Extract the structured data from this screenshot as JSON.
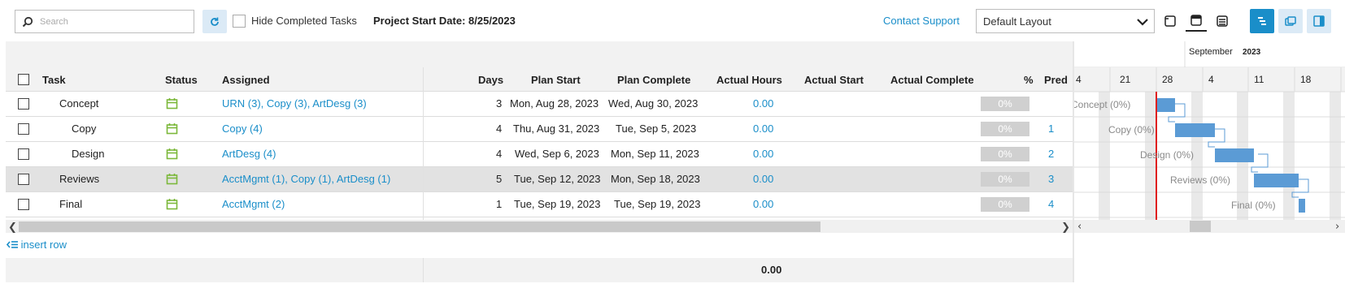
{
  "toolbar": {
    "search_placeholder": "Search",
    "hide_completed_label": "Hide Completed Tasks",
    "project_start_label": "Project Start Date: 8/25/2023",
    "contact_support": "Contact Support",
    "layout_value": "Default Layout"
  },
  "columns": {
    "task": "Task",
    "status": "Status",
    "assigned": "Assigned",
    "days": "Days",
    "plan_start": "Plan Start",
    "plan_complete": "Plan Complete",
    "actual_hours": "Actual Hours",
    "actual_start": "Actual Start",
    "actual_complete": "Actual Complete",
    "pct": "%",
    "pred": "Pred"
  },
  "rows": [
    {
      "task": "Concept",
      "assigned": "URN (3), Copy (3), ArtDesg (3)",
      "days": "3",
      "plan_start": "Mon, Aug 28, 2023",
      "plan_complete": "Wed, Aug 30, 2023",
      "actual_hours": "0.00",
      "pct": "0%",
      "pred": ""
    },
    {
      "task": "Copy",
      "assigned": "Copy (4)",
      "days": "4",
      "plan_start": "Thu, Aug 31, 2023",
      "plan_complete": "Tue, Sep 5, 2023",
      "actual_hours": "0.00",
      "pct": "0%",
      "pred": "1"
    },
    {
      "task": "Design",
      "assigned": "ArtDesg (4)",
      "days": "4",
      "plan_start": "Wed, Sep 6, 2023",
      "plan_complete": "Mon, Sep 11, 2023",
      "actual_hours": "0.00",
      "pct": "0%",
      "pred": "2"
    },
    {
      "task": "Reviews",
      "assigned": "AcctMgmt (1), Copy (1), ArtDesg (1)",
      "days": "5",
      "plan_start": "Tue, Sep 12, 2023",
      "plan_complete": "Mon, Sep 18, 2023",
      "actual_hours": "0.00",
      "pct": "0%",
      "pred": "3"
    },
    {
      "task": "Final",
      "assigned": "AcctMgmt (2)",
      "days": "1",
      "plan_start": "Tue, Sep 19, 2023",
      "plan_complete": "Tue, Sep 19, 2023",
      "actual_hours": "0.00",
      "pct": "0%",
      "pred": "4"
    }
  ],
  "insert_row": "insert row",
  "footer_total": "0.00",
  "gantt": {
    "month_label": "September",
    "month_year": "2023",
    "week_labels": [
      "4",
      "21",
      "28",
      "4",
      "11",
      "18"
    ],
    "bar_labels": [
      "Concept (0%)",
      "Copy (0%)",
      "Design (0%)",
      "Reviews (0%)",
      "Final (0%)"
    ],
    "today_line_color": "#e02020",
    "bar_color": "#5b9bd5"
  },
  "colors": {
    "accent": "#1a8ec9",
    "status_green": "#7cb83b",
    "selected_row": "#e2e2e2"
  }
}
